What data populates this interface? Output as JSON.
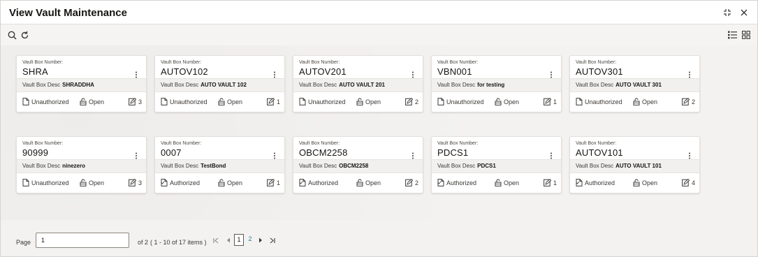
{
  "window": {
    "title": "View Vault Maintenance",
    "controls": {
      "resize_icon": "resize-icon",
      "close_icon": "close-icon"
    }
  },
  "toolbar": {
    "search_icon": "search-icon",
    "refresh_icon": "refresh-icon",
    "list_view_icon": "list-view-icon",
    "grid_view_icon": "grid-view-icon"
  },
  "cards": [
    {
      "label": "Vault Box Number:",
      "number": "SHRA",
      "desc_label": "Vault Box Desc",
      "desc": "SHRADDHA",
      "auth": "Unauthorized",
      "status": "Open",
      "mods": "3"
    },
    {
      "label": "Vault Box Number:",
      "number": "AUTOV102",
      "desc_label": "Vault Box Desc",
      "desc": "AUTO VAULT 102",
      "auth": "Unauthorized",
      "status": "Open",
      "mods": "1"
    },
    {
      "label": "Vault Box Number:",
      "number": "AUTOV201",
      "desc_label": "Vault Box Desc",
      "desc": "AUTO VAULT 201",
      "auth": "Unauthorized",
      "status": "Open",
      "mods": "2"
    },
    {
      "label": "Vault Box Number:",
      "number": "VBN001",
      "desc_label": "Vault Box Desc",
      "desc": "for testing",
      "auth": "Unauthorized",
      "status": "Open",
      "mods": "1"
    },
    {
      "label": "Vault Box Number:",
      "number": "AUTOV301",
      "desc_label": "Vault Box Desc",
      "desc": "AUTO VAULT 301",
      "auth": "Unauthorized",
      "status": "Open",
      "mods": "2"
    },
    {
      "label": "Vault Box Number:",
      "number": "90999",
      "desc_label": "Vault Box Desc",
      "desc": "ninezero",
      "auth": "Unauthorized",
      "status": "Open",
      "mods": "3"
    },
    {
      "label": "Vault Box Number:",
      "number": "0007",
      "desc_label": "Vault Box Desc",
      "desc": "TestBond",
      "auth": "Authorized",
      "status": "Open",
      "mods": "1"
    },
    {
      "label": "Vault Box Number:",
      "number": "OBCM2258",
      "desc_label": "Vault Box Desc",
      "desc": "OBCM2258",
      "auth": "Authorized",
      "status": "Open",
      "mods": "2"
    },
    {
      "label": "Vault Box Number:",
      "number": "PDCS1",
      "desc_label": "Vault Box Desc",
      "desc": "PDCS1",
      "auth": "Authorized",
      "status": "Open",
      "mods": "1"
    },
    {
      "label": "Vault Box Number:",
      "number": "AUTOV101",
      "desc_label": "Vault Box Desc",
      "desc": "AUTO VAULT 101",
      "auth": "Authorized",
      "status": "Open",
      "mods": "4"
    }
  ],
  "pagination": {
    "page_label": "Page",
    "page_value": "1",
    "of_label": "of 2",
    "items_label": "( 1 - 10 of 17 items )",
    "pages": [
      "1",
      "2"
    ],
    "current_page": "1",
    "icons": [
      "first-page-icon",
      "prev-page-icon",
      "next-page-icon",
      "last-page-icon"
    ]
  },
  "colors": {
    "link": "#227e9e",
    "background": "#f3f2f0",
    "card": "#ffffff"
  }
}
